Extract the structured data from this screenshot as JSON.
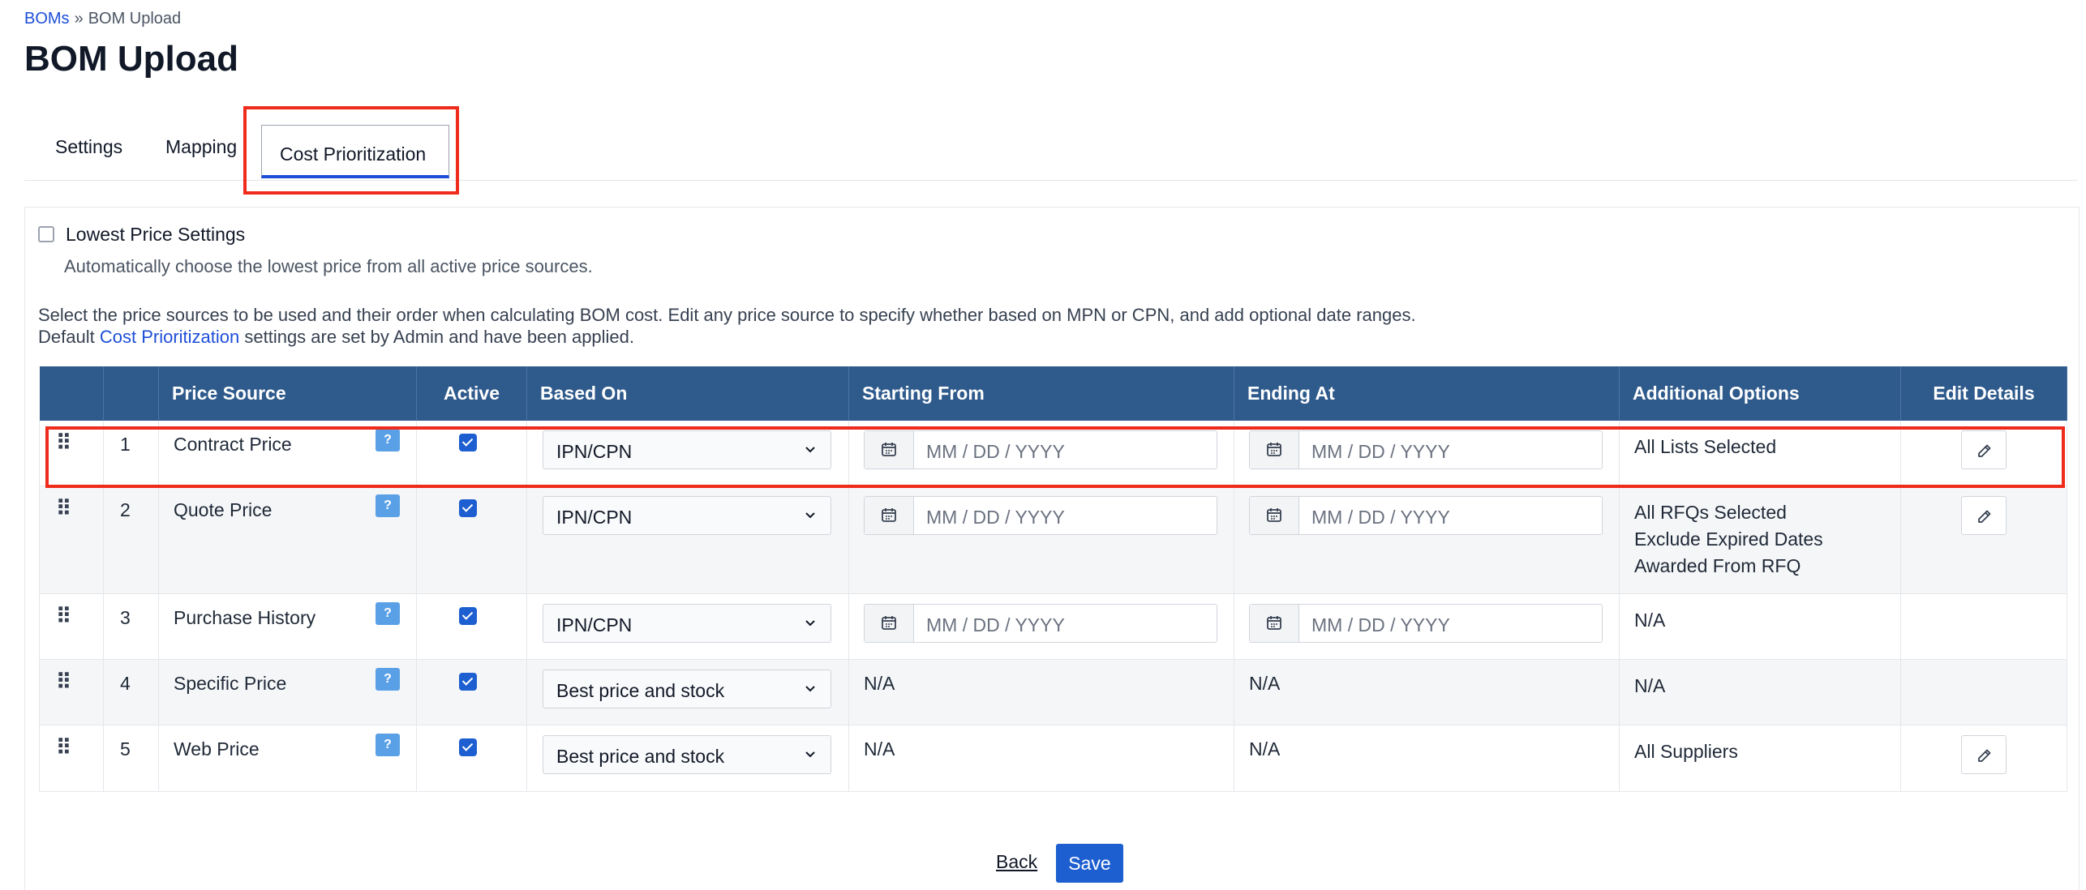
{
  "breadcrumb": {
    "parent": "BOMs",
    "separator": "»",
    "current": "BOM Upload"
  },
  "page_title": "BOM Upload",
  "tabs": [
    {
      "label": "Settings",
      "active": false
    },
    {
      "label": "Mapping",
      "active": false
    },
    {
      "label": "Cost Prioritization",
      "active": true
    }
  ],
  "lowest_price": {
    "label": "Lowest Price Settings",
    "checked": false,
    "description": "Automatically choose the lowest price from all active price sources."
  },
  "instructions": {
    "line1": "Select the price sources to be used and their order when calculating BOM cost. Edit any price source to specify whether based on MPN or CPN, and add optional date ranges.",
    "line2_prefix": "Default",
    "line2_link": "Cost Prioritization",
    "line2_suffix": "settings are set by Admin and have been applied."
  },
  "table": {
    "headers": [
      "",
      "",
      "Price Source",
      "Active",
      "Based On",
      "Starting From",
      "Ending At",
      "Additional Options",
      "Edit Details"
    ],
    "date_placeholder": "MM / DD / YYYY",
    "help_label": "?",
    "rows": [
      {
        "num": "1",
        "source": "Contract Price",
        "active": true,
        "based_on": "IPN/CPN",
        "start": "",
        "end": "",
        "options": [
          "All Lists Selected"
        ],
        "editable": true
      },
      {
        "num": "2",
        "source": "Quote Price",
        "active": true,
        "based_on": "IPN/CPN",
        "start": "",
        "end": "",
        "options": [
          "All RFQs Selected",
          "Exclude Expired Dates",
          "Awarded From RFQ"
        ],
        "editable": true
      },
      {
        "num": "3",
        "source": "Purchase History",
        "active": true,
        "based_on": "IPN/CPN",
        "start": "",
        "end": "",
        "options": [
          "N/A"
        ],
        "editable": false
      },
      {
        "num": "4",
        "source": "Specific Price",
        "active": true,
        "based_on": "Best price and stock",
        "start": "N/A",
        "end": "N/A",
        "options": [
          "N/A"
        ],
        "editable": false
      },
      {
        "num": "5",
        "source": "Web Price",
        "active": true,
        "based_on": "Best price and stock",
        "start": "N/A",
        "end": "N/A",
        "options": [
          "All Suppliers"
        ],
        "editable": true
      }
    ]
  },
  "footer": {
    "back_label": "Back",
    "save_label": "Save"
  },
  "colors": {
    "header_bg": "#2f5a8c",
    "primary": "#1d5fd0",
    "highlight": "#ef2b1c",
    "help_badge": "#5aa0e6"
  }
}
